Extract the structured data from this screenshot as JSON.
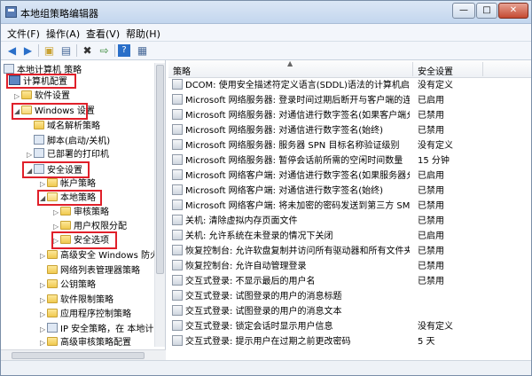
{
  "window": {
    "title": "本地组策略编辑器",
    "controls": {
      "minimize": "—",
      "maximize": "□",
      "close": "✕"
    }
  },
  "menubar": [
    "文件(F)",
    "操作(A)",
    "查看(V)",
    "帮助(H)"
  ],
  "toolbar_icons": [
    "back-icon",
    "forward-icon",
    "up-folder-icon",
    "show-tree-icon",
    "delete-icon",
    "export-icon",
    "help-icon",
    "properties-icon"
  ],
  "tree": {
    "items": [
      {
        "label": "本地计算机 策略"
      },
      {
        "label": "计算机配置"
      },
      {
        "label": "软件设置"
      },
      {
        "label": "Windows 设置"
      },
      {
        "label": "域名解析策略"
      },
      {
        "label": "脚本(启动/关机)"
      },
      {
        "label": "已部署的打印机"
      },
      {
        "label": "安全设置"
      },
      {
        "label": "帐户策略"
      },
      {
        "label": "本地策略"
      },
      {
        "label": "审核策略"
      },
      {
        "label": "用户权限分配"
      },
      {
        "label": "安全选项"
      },
      {
        "label": "高级安全 Windows 防火"
      },
      {
        "label": "网络列表管理器策略"
      },
      {
        "label": "公钥策略"
      },
      {
        "label": "软件限制策略"
      },
      {
        "label": "应用程序控制策略"
      },
      {
        "label": "IP 安全策略，在 本地计"
      },
      {
        "label": "高级审核策略配置"
      }
    ]
  },
  "list": {
    "columns": {
      "policy": "策略",
      "security": "安全设置"
    },
    "rows": [
      {
        "policy": "DCOM: 使用安全描述符定义语言(SDDL)语法的计算机启动...",
        "security": "没有定义"
      },
      {
        "policy": "Microsoft 网络服务器: 登录时间过期后断开与客户端的连接",
        "security": "已启用"
      },
      {
        "policy": "Microsoft 网络服务器: 对通信进行数字签名(如果客户端允...",
        "security": "已禁用"
      },
      {
        "policy": "Microsoft 网络服务器: 对通信进行数字签名(始终)",
        "security": "已禁用"
      },
      {
        "policy": "Microsoft 网络服务器: 服务器 SPN 目标名称验证级别",
        "security": "没有定义"
      },
      {
        "policy": "Microsoft 网络服务器: 暂停会话前所需的空闲时间数量",
        "security": "15 分钟"
      },
      {
        "policy": "Microsoft 网络客户端: 对通信进行数字签名(如果服务器允...",
        "security": "已启用"
      },
      {
        "policy": "Microsoft 网络客户端: 对通信进行数字签名(始终)",
        "security": "已禁用"
      },
      {
        "policy": "Microsoft 网络客户端: 将未加密的密码发送到第三方 SMB...",
        "security": "已禁用"
      },
      {
        "policy": "关机: 清除虚拟内存页面文件",
        "security": "已禁用"
      },
      {
        "policy": "关机: 允许系统在未登录的情况下关闭",
        "security": "已启用"
      },
      {
        "policy": "恢复控制台: 允许软盘复制并访问所有驱动器和所有文件夹",
        "security": "已禁用"
      },
      {
        "policy": "恢复控制台: 允许自动管理登录",
        "security": "已禁用"
      },
      {
        "policy": "交互式登录: 不显示最后的用户名",
        "security": "已禁用"
      },
      {
        "policy": "交互式登录: 试图登录的用户的消息标题",
        "security": ""
      },
      {
        "policy": "交互式登录: 试图登录的用户的消息文本",
        "security": ""
      },
      {
        "policy": "交互式登录: 锁定会话时显示用户信息",
        "security": "没有定义"
      },
      {
        "policy": "交互式登录: 提示用户在过期之前更改密码",
        "security": "5 天"
      }
    ]
  },
  "colors": {
    "highlight_box": "#e0202a",
    "title_bar": "#c3d6ee"
  }
}
